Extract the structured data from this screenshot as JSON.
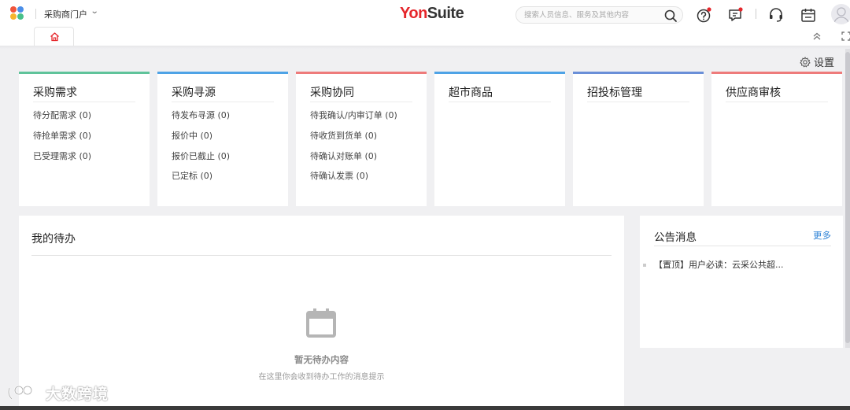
{
  "header": {
    "portal_name": "采购商门户",
    "brand_yon": "Yon",
    "brand_suite": "Suite",
    "search_placeholder": "搜索人员信息、服务及其他内容"
  },
  "settings_label": "设置",
  "cards": [
    {
      "title": "采购需求",
      "color": "#5fc39a",
      "items": [
        "待分配需求 (0)",
        "待抢单需求 (0)",
        "已受理需求 (0)"
      ]
    },
    {
      "title": "采购寻源",
      "color": "#4ea3e6",
      "items": [
        "待发布寻源 (0)",
        "报价中 (0)",
        "报价已截止 (0)",
        "已定标 (0)"
      ]
    },
    {
      "title": "采购协同",
      "color": "#ee7b7b",
      "items": [
        "待我确认/内审订单 (0)",
        "待收货到货单 (0)",
        "待确认对账单 (0)",
        "待确认发票 (0)"
      ]
    },
    {
      "title": "超市商品",
      "color": "#4ea3e6",
      "items": []
    },
    {
      "title": "招投标管理",
      "color": "#6a8fd8",
      "items": []
    },
    {
      "title": "供应商审核",
      "color": "#ee7b7b",
      "items": []
    }
  ],
  "todo": {
    "title": "我的待办",
    "empty_title": "暂无待办内容",
    "empty_hint": "在这里你会收到待办工作的消息提示"
  },
  "notice": {
    "title": "公告消息",
    "more": "更多",
    "items": [
      "【置顶】用户必读：云采公共超..."
    ]
  },
  "watermark": "大数跨境"
}
